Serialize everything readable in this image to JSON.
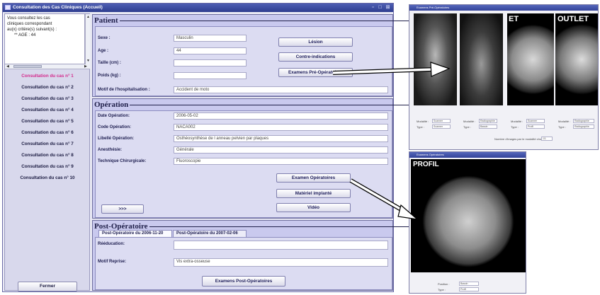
{
  "window": {
    "title": "Consultation des Cas Cliniques (Accueil)"
  },
  "sidebar": {
    "criteria_text": [
      "Vous consultez les cas",
      "cliniques correspondant",
      "au(x) critère(s) suivant(s) :",
      "** AGE : 44"
    ],
    "cases": [
      {
        "label": "Consultation du cas n° 1",
        "active": true
      },
      {
        "label": "Consultation du cas n° 2",
        "active": false
      },
      {
        "label": "Consultation du cas n° 3",
        "active": false
      },
      {
        "label": "Consultation du cas n° 4",
        "active": false
      },
      {
        "label": "Consultation du cas n° 5",
        "active": false
      },
      {
        "label": "Consultation du cas n° 6",
        "active": false
      },
      {
        "label": "Consultation du cas n° 7",
        "active": false
      },
      {
        "label": "Consultation du cas n° 8",
        "active": false
      },
      {
        "label": "Consultation du cas n° 9",
        "active": false
      },
      {
        "label": "Consultation du cas n° 10",
        "active": false
      }
    ],
    "close_label": "Fermer"
  },
  "patient": {
    "title": "Patient",
    "sexe_label": "Sexe :",
    "sexe_value": "Masculin",
    "age_label": "Age :",
    "age_value": "44",
    "taille_label": "Taille (cm) :",
    "taille_value": "",
    "poids_label": "Poids (kg) :",
    "poids_value": "",
    "motif_label": "Motif de l'hospitalisation :",
    "motif_value": "Accident de moto",
    "btn_lesion": "Lésion",
    "btn_contre": "Contre-indications",
    "btn_preop": "Examens Pré-Opératoires"
  },
  "operation": {
    "title": "Opération",
    "date_label": "Date Opération:",
    "date_value": "2006-05-02",
    "code_label": "Code Opération:",
    "code_value": "NACA002",
    "libelle_label": "Libellé Opération:",
    "libelle_value": "Osthéosynthèse de l anneau pelvien par plaques",
    "anesthesie_label": "Anesthésie:",
    "anesthesie_value": "Générale",
    "technique_label": "Technique Chirurgicale:",
    "technique_value": "Fluoroscopie",
    "btn_examen_op": "Examen Opératoires",
    "btn_materiel": "Matériel implanté",
    "btn_video": "Vidéo",
    "btn_next": ">>>"
  },
  "postop": {
    "title": "Post-Opératoire",
    "tabs": [
      "Post-Opératoire du 2006-11-20",
      "Post-Opératoire du 2007-02-06"
    ],
    "reeducation_label": "Rééducation:",
    "reeducation_value": "",
    "motif_label": "Motif Reprise:",
    "motif_value": "Vis extra-osseuse",
    "btn_examens_postop": "Examens Post-Opératoires"
  },
  "viewer_preop": {
    "title": "Examens Pré-Opératoires",
    "image_labels": [
      "ET",
      "OUTLET"
    ],
    "field_labels": [
      "Modalité :",
      "Type :"
    ],
    "modalite_values": [
      "Scanner",
      "Radiographie",
      "Scanner",
      "Radiographie"
    ],
    "type_values": [
      "Scanner",
      "Bassin",
      "Profil",
      "Radiographie"
    ],
    "bottom_label": "Nombre d'images par le modalité choisie :",
    "bottom_value": "1/1"
  },
  "viewer_op": {
    "title": "Examens Opératoires",
    "image_label": "PROFIL",
    "field1_label": "Position :",
    "field1_value": "Bassin",
    "field2_label": "Type :",
    "field2_value": "Profil"
  },
  "colors": {
    "accent": "#2e3d8f",
    "active_case": "#d42a8c",
    "section_bg": "#c9c9ee"
  }
}
